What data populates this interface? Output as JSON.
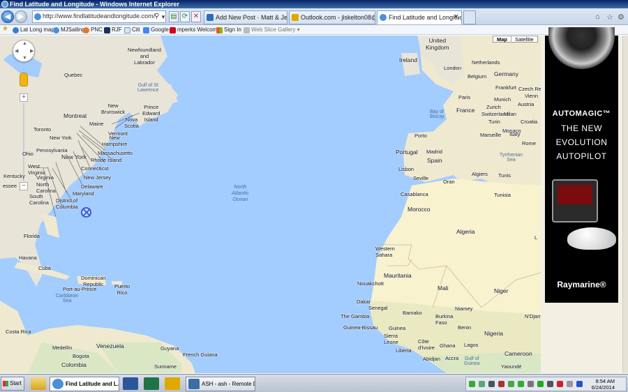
{
  "window": {
    "title": "Find Latitude and Longitude - Windows Internet Explorer"
  },
  "toolbar": {
    "url": "http://www.findlatitudeandlongitude.com/",
    "tabs": [
      {
        "label": "Add New Post · Matt & Jessica's..."
      },
      {
        "label": "Outlook.com - jlskelton08@hot..."
      },
      {
        "label": "Find Latitude and Longitude"
      }
    ]
  },
  "favorites": [
    "Lat Long map",
    "MJSailing",
    "PNC",
    "RJF",
    "Citi",
    "Google",
    "mperks Welcome",
    "Sign In",
    "Web Slice Gallery"
  ],
  "map": {
    "controls": {
      "map": "Map",
      "satellite": "Satellite"
    },
    "labels": {
      "newfoundland": "Newfoundland\nand\nLabrador",
      "quebec": "Quebec",
      "gulf": "Gulf of St\nLawrence",
      "newbrunswick": "New\nBrunswick",
      "pei": "Prince\nEdward\nIsland",
      "novascotia": "Nova\nScotia",
      "montreal": "Montreal",
      "maine": "Maine",
      "toronto": "Toronto",
      "vermont": "Vermont",
      "newhampshire": "New\nHampshire",
      "newyork1": "New York",
      "massachusetts": "Massachusetts",
      "pennsylvania": "Pennsylvania",
      "ohio": "Ohio",
      "newyork2": "New York",
      "rhodeisland": "Rhode Island",
      "connecticut": "Connecticut",
      "westvirginia": "West\nVirginia",
      "virginia": "Virginia",
      "newjersey": "New Jersey",
      "kentucky": "Kentucky",
      "northcarolina": "North\nCarolina",
      "delaware": "Delaware",
      "essee": "essee",
      "southcarolina": "South\nCarolina",
      "maryland": "Maryland",
      "dc": "District of\nColumbia",
      "florida": "Florida",
      "havana": "Havana",
      "cuba": "Cuba",
      "dominican": "Dominican\nRepublic",
      "puertorico": "Puerto\nRico",
      "portauprince": "Port-au-Prince",
      "caribbean": "Caribbean\nSea",
      "costarica": "Costa Rica",
      "medellin": "Medellín",
      "colombia": "Colombia",
      "bogota": "Bogota",
      "venezuela": "Venezuela",
      "guyana": "Guyana",
      "frenchguiana": "French Guiana",
      "suriname": "Suriname",
      "ocean": "North\nAtlantic\nOcean",
      "unitedkingdom": "United\nKingdom",
      "ireland": "Ireland",
      "london": "London",
      "netherlands": "Netherlands",
      "belgium": "Belgium",
      "germany": "Germany",
      "frankfurt": "Frankfurt",
      "czech": "Czech Re",
      "paris": "Paris",
      "munich": "Munich",
      "vienna": "Vienn",
      "austria": "Austria",
      "zurich": "Zurich",
      "switzerland": "Switzerland",
      "milan": "Milan",
      "baybiscay": "Bay of\nBiscay",
      "france": "France",
      "turin": "Turin",
      "croatia": "Croatia",
      "monaco": "Monaco",
      "marseille": "Marseille",
      "italy": "Italy",
      "rome": "Rome",
      "porto": "Porto",
      "portugal": "Portugal",
      "madrid": "Madrid",
      "spain": "Spain",
      "tyrrhenian": "Tyrrhenian\nSea",
      "lisbon": "Lisbon",
      "seville": "Seville",
      "algiers": "Algiers",
      "tunis": "Tunis",
      "oran": "Oran",
      "casablanca": "Casablanca",
      "tunisia": "Tunisia",
      "morocco": "Morocco",
      "algeria": "Algeria",
      "westernsahara": "Western\nSahara",
      "mauritania": "Mauritania",
      "nouakchott": "Nouakchott",
      "mali": "Mali",
      "niger": "Niger",
      "dakar": "Dakar",
      "senegal": "Senegal",
      "thegambia": "The Gambia",
      "bamako": "Bamako",
      "niamey": "Niamey",
      "ndjamena": "N'Djamen",
      "guineabissau": "Guinea-Bissau",
      "guinea": "Guinea",
      "burkinafaso": "Burkina\nFaso",
      "benin": "Benin",
      "sierraleone": "Sierra\nLeone",
      "cotedivoire": "Côte\nd'Ivoire",
      "ghana": "Ghana",
      "nigeria": "Nigeria",
      "lagos": "Lagos",
      "liberia": "Liberia",
      "abidjan": "Abidjan",
      "accra": "Accra",
      "cameroon": "Cameroon",
      "gulfguinea": "Gulf of\nGuinea",
      "yaounde": "Yaoundé",
      "l": "L"
    }
  },
  "ad": {
    "line1": "AUTOMAGIC™",
    "line2": "THE NEW",
    "line3": "EVOLUTION",
    "line4": "AUTOPILOT",
    "brand": "Raymarine®"
  },
  "taskbar": {
    "start": "Start",
    "buttons": [
      "Find Latitude and L...",
      "ASH - ash - Remote D..."
    ],
    "time": "8:54 AM",
    "date": "6/24/2014"
  }
}
